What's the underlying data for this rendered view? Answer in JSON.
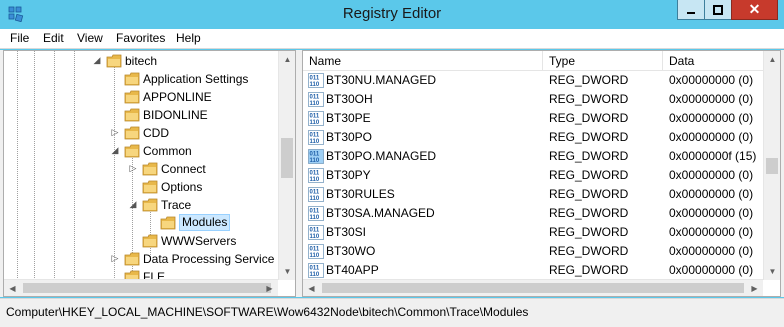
{
  "window": {
    "title": "Registry Editor",
    "close_glyph": "✕"
  },
  "menu": [
    "File",
    "Edit",
    "View",
    "Favorites",
    "Help"
  ],
  "tree": [
    {
      "label": "bitech",
      "expander": "open",
      "level": 0
    },
    {
      "label": "Application Settings",
      "expander": "none",
      "level": 1
    },
    {
      "label": "APPONLINE",
      "expander": "none",
      "level": 1
    },
    {
      "label": "BIDONLINE",
      "expander": "none",
      "level": 1
    },
    {
      "label": "CDD",
      "expander": "closed",
      "level": 1
    },
    {
      "label": "Common",
      "expander": "open",
      "level": 1
    },
    {
      "label": "Connect",
      "expander": "closed",
      "level": 2
    },
    {
      "label": "Options",
      "expander": "none",
      "level": 2
    },
    {
      "label": "Trace",
      "expander": "open",
      "level": 2
    },
    {
      "label": "Modules",
      "expander": "none",
      "level": 3,
      "selected": true
    },
    {
      "label": "WWWServers",
      "expander": "none",
      "level": 2
    },
    {
      "label": "Data Processing Service",
      "expander": "closed",
      "level": 1
    },
    {
      "label": "FLE",
      "expander": "none",
      "level": 1
    }
  ],
  "columns": {
    "name": "Name",
    "type": "Type",
    "data": "Data"
  },
  "values": [
    {
      "name": "BT30NU.MANAGED",
      "type": "REG_DWORD",
      "data": "0x00000000 (0)"
    },
    {
      "name": "BT30OH",
      "type": "REG_DWORD",
      "data": "0x00000000 (0)"
    },
    {
      "name": "BT30PE",
      "type": "REG_DWORD",
      "data": "0x00000000 (0)"
    },
    {
      "name": "BT30PO",
      "type": "REG_DWORD",
      "data": "0x00000000 (0)"
    },
    {
      "name": "BT30PO.MANAGED",
      "type": "REG_DWORD",
      "data": "0x0000000f (15)",
      "highlight": true
    },
    {
      "name": "BT30PY",
      "type": "REG_DWORD",
      "data": "0x00000000 (0)"
    },
    {
      "name": "BT30RULES",
      "type": "REG_DWORD",
      "data": "0x00000000 (0)"
    },
    {
      "name": "BT30SA.MANAGED",
      "type": "REG_DWORD",
      "data": "0x00000000 (0)"
    },
    {
      "name": "BT30SI",
      "type": "REG_DWORD",
      "data": "0x00000000 (0)"
    },
    {
      "name": "BT30WO",
      "type": "REG_DWORD",
      "data": "0x00000000 (0)"
    },
    {
      "name": "BT40APP",
      "type": "REG_DWORD",
      "data": "0x00000000 (0)"
    }
  ],
  "status": {
    "path": "Computer\\HKEY_LOCAL_MACHINE\\SOFTWARE\\Wow6432Node\\bitech\\Common\\Trace\\Modules"
  },
  "colors": {
    "titlebar": "#5bc8ea",
    "selection": "#cce8ff",
    "folder": "#e8b84a",
    "close": "#c73a2c"
  },
  "scroll": {
    "tree_vertical_fraction": 0.45,
    "list_vertical_fraction": 0.5
  }
}
